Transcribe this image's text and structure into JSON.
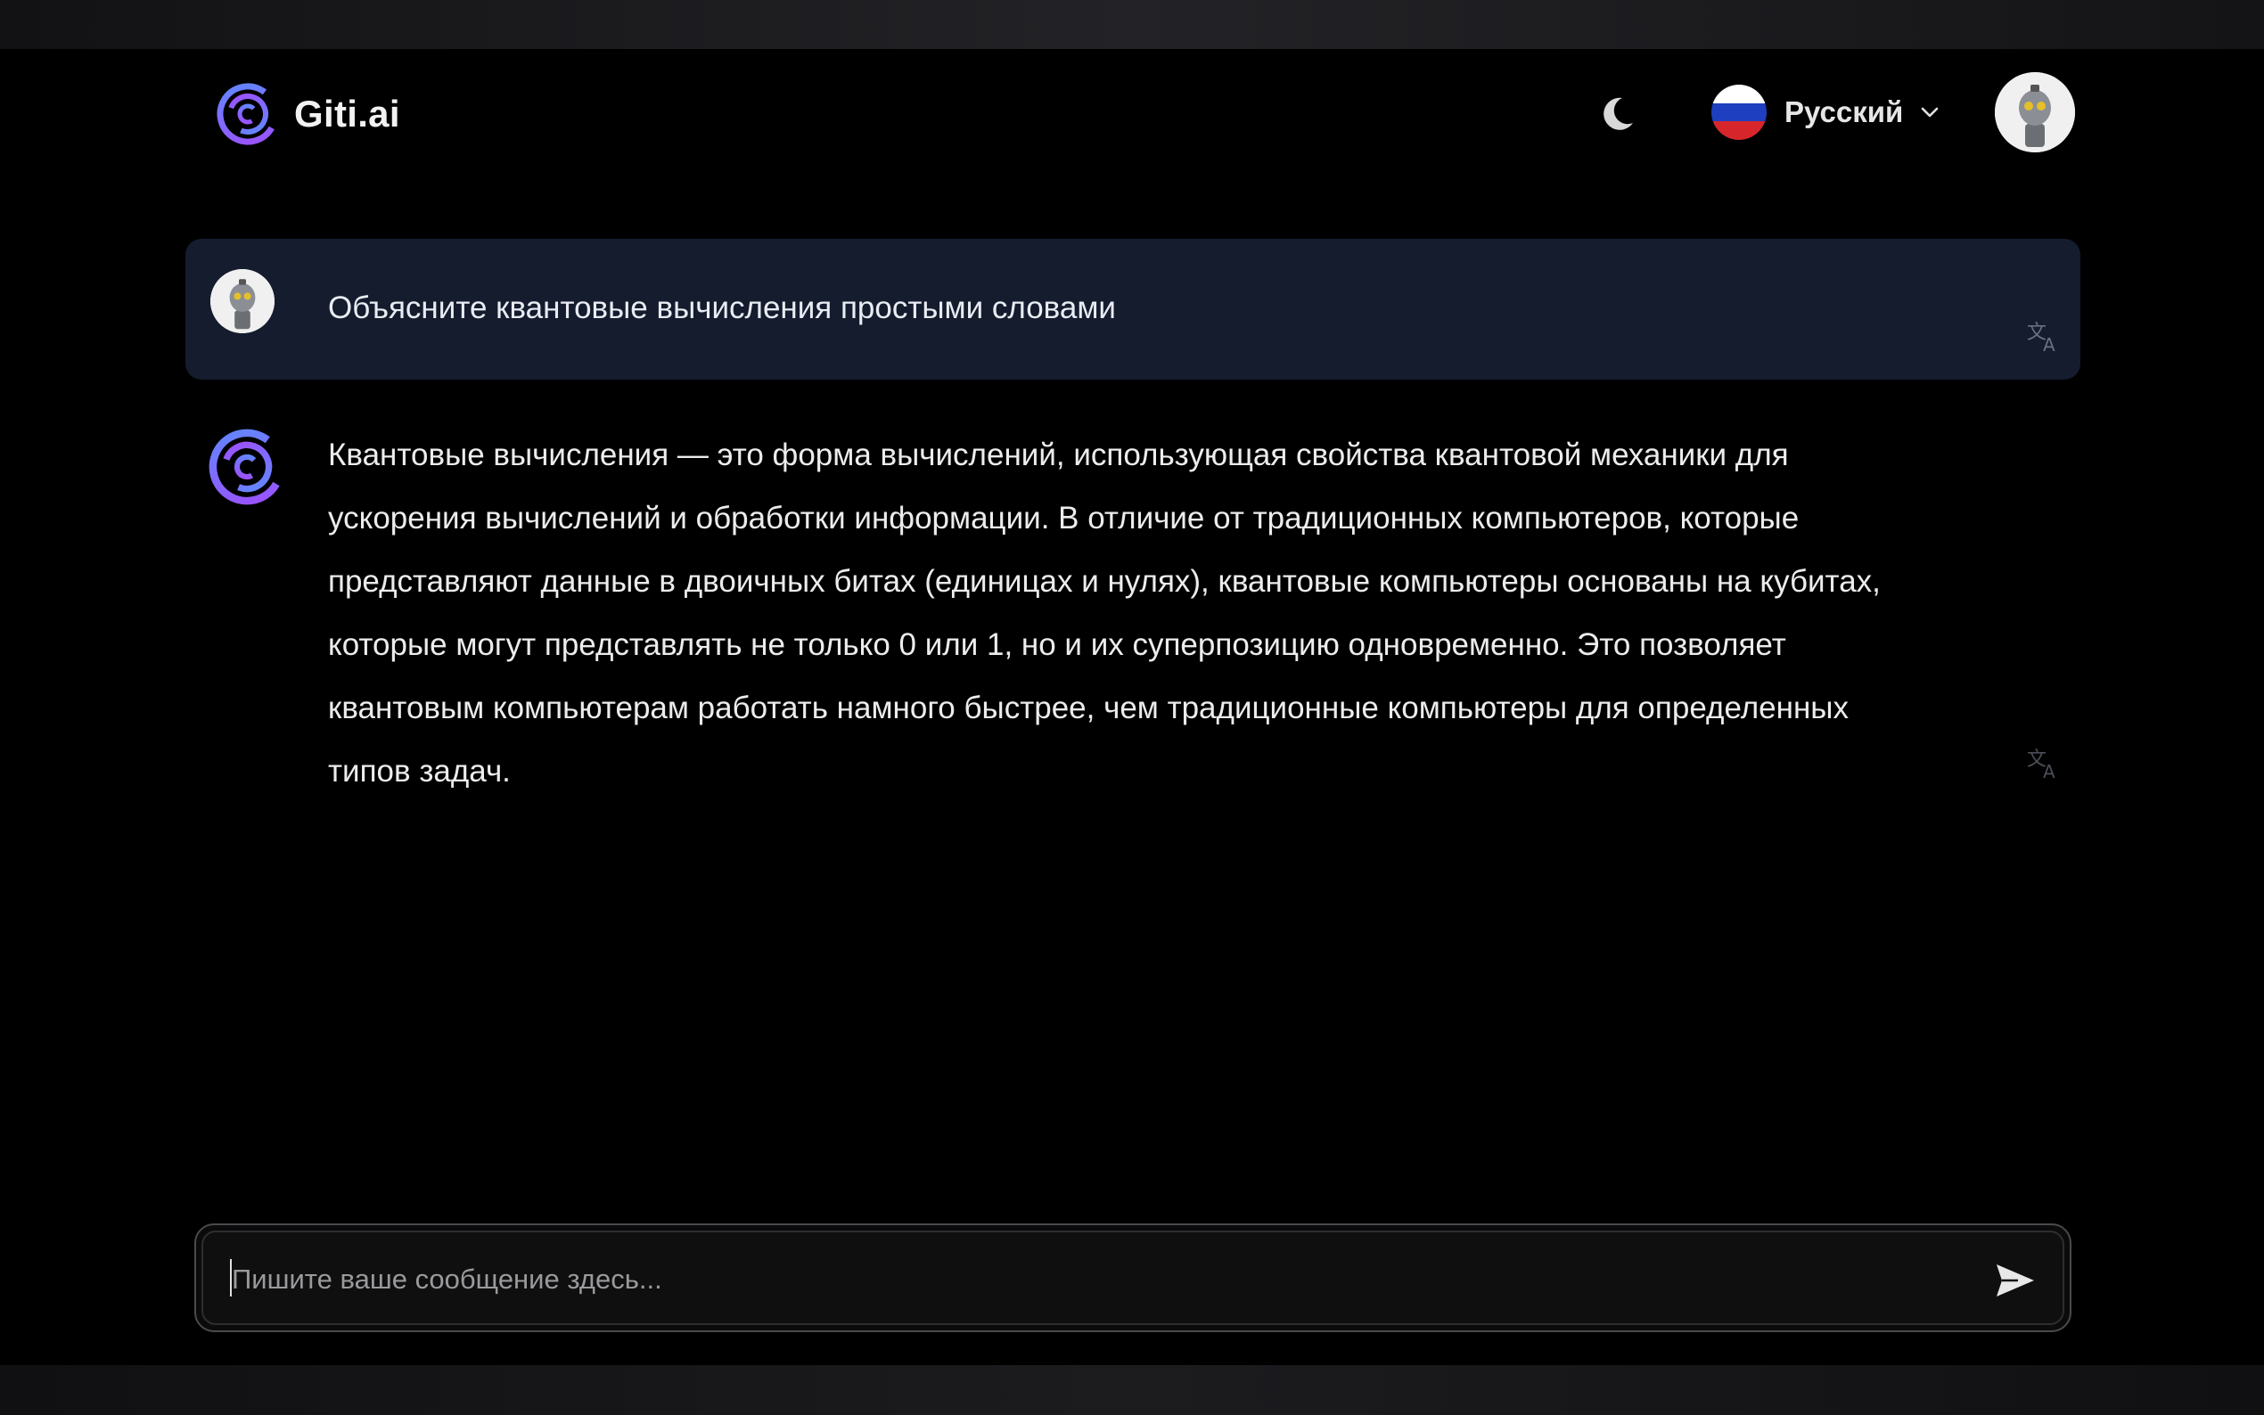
{
  "header": {
    "app_name": "Giti.ai",
    "language": {
      "label": "Русский",
      "flag_colors": [
        "#ffffff",
        "#1e3fbf",
        "#d6262c"
      ]
    },
    "icons": {
      "logo": "spiral-logo-icon",
      "theme": "moon-icon",
      "chevron": "chevron-down-icon",
      "avatar": "robot-avatar"
    }
  },
  "conversation": {
    "user_message": {
      "text": "Объясните квантовые вычисления простыми словами"
    },
    "assistant_message": {
      "lines": [
        "Квантовые вычисления — это форма вычислений, использующая свойства квантовой механики для",
        "ускорения вычислений и обработки информации. В отличие от традиционных компьютеров, которые",
        "представляют данные в двоичных битах (единицах и нулях), квантовые компьютеры основаны на кубитах,",
        "которые могут представлять не только 0 или 1, но и их суперпозицию одновременно. Это позволяет",
        "квантовым компьютерам работать намного быстрее, чем традиционные компьютеры для определенных",
        "типов задач."
      ]
    }
  },
  "composer": {
    "placeholder": "Пишите ваше сообщение здесь...",
    "value": ""
  },
  "colors": {
    "background": "#000000",
    "user_bubble": "#141c2e",
    "accent_purple": "#7c5cff",
    "accent_blue": "#3b7bff"
  }
}
